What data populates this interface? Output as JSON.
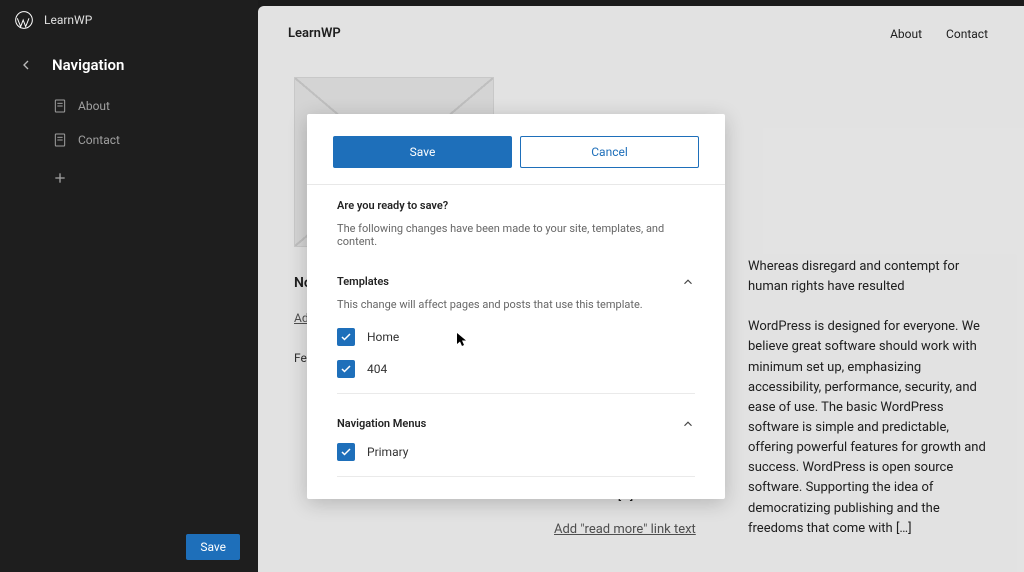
{
  "sidebar": {
    "site_name": "LearnWP",
    "nav_title": "Navigation",
    "items": [
      {
        "label": "About"
      },
      {
        "label": "Contact"
      }
    ],
    "bottom_save": "Save"
  },
  "preview": {
    "site_title": "LearnWP",
    "nav": {
      "about": "About",
      "contact": "Contact"
    },
    "no_post": "No po",
    "add_text": "Add \"",
    "date_text": "Febru",
    "mid_text": "WordPress is built on PHP and MySQL, and licensed under the GPLv2. It is also the platform of choice for over 43% of all sites across the […]",
    "read_more": "Add \"read more\" link text",
    "right_p1": "Whereas disregard and contempt for human rights have resulted",
    "right_p2": "WordPress is designed for everyone. We believe great software should work with minimum set up, emphasizing accessibility, performance, security, and ease of use. The basic WordPress software is simple and predictable, offering powerful features for growth and success. WordPress is open source software. Supporting the idea of democratizing publishing and the freedoms that come with […]"
  },
  "dialog": {
    "save": "Save",
    "cancel": "Cancel",
    "question": "Are you ready to save?",
    "description": "The following changes have been made to your site, templates, and content.",
    "templates": {
      "title": "Templates",
      "sub": "This change will affect pages and posts that use this template.",
      "items": [
        {
          "label": "Home"
        },
        {
          "label": "404"
        }
      ]
    },
    "navmenus": {
      "title": "Navigation Menus",
      "items": [
        {
          "label": "Primary"
        }
      ]
    }
  }
}
